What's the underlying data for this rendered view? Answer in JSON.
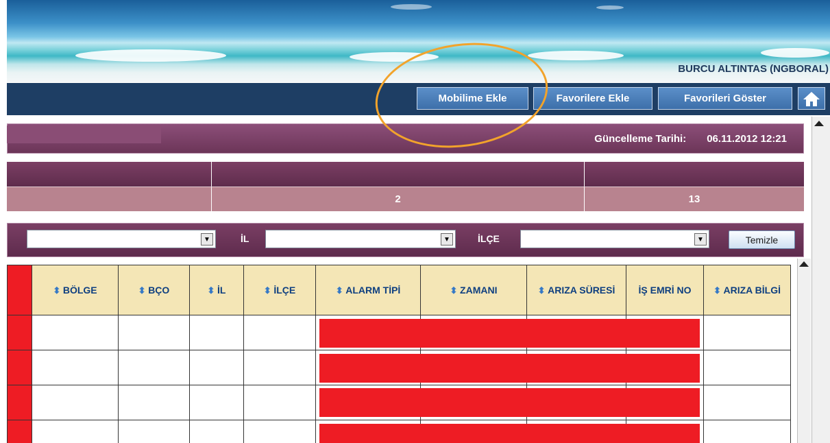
{
  "header": {
    "user": "BURCU ALTINTAS (NGBORAL)"
  },
  "nav": {
    "buttons": [
      "Mobilime Ekle",
      "Favorilere Ekle",
      "Favorileri Göster"
    ],
    "home_icon": "home-icon"
  },
  "update": {
    "label": "Güncelleme Tarihi:",
    "value": "06.11.2012 12:21"
  },
  "summary": {
    "values": [
      "",
      "2",
      "13"
    ]
  },
  "filter": {
    "il_label": "İL",
    "ilce_label": "İLÇE",
    "clear_label": "Temizle"
  },
  "grid": {
    "columns": [
      {
        "label": "",
        "sortable": false
      },
      {
        "label": "BÖLGE",
        "sortable": true
      },
      {
        "label": "BÇO",
        "sortable": true
      },
      {
        "label": "İL",
        "sortable": true
      },
      {
        "label": "İLÇE",
        "sortable": true
      },
      {
        "label": "ALARM TİPİ",
        "sortable": true
      },
      {
        "label": "ZAMANI",
        "sortable": true
      },
      {
        "label": "ARIZA SÜRESİ",
        "sortable": true
      },
      {
        "label": "İŞ EMRİ NO",
        "sortable": false
      },
      {
        "label": "ARIZA BİLGİ",
        "sortable": true
      }
    ]
  },
  "colors": {
    "navbar": "#1e3e64",
    "accent_purple": "#6c3558",
    "header_bg": "#f4e6b6",
    "alarm_red": "#ee1c24",
    "highlight": "#f2a32b"
  }
}
